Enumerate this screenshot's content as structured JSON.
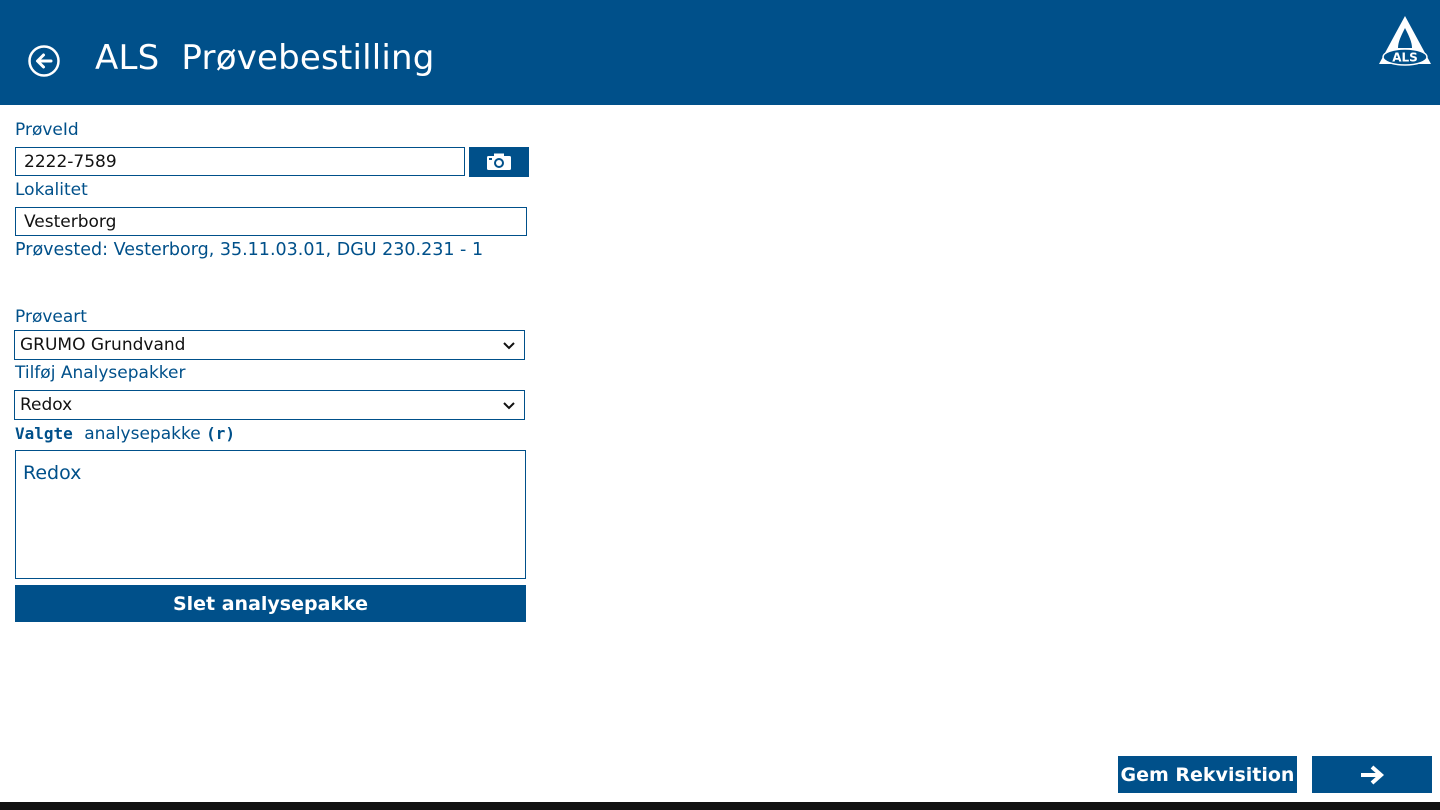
{
  "colors": {
    "brand": "#00508a",
    "background": "#ffffff",
    "text": "#111111"
  },
  "header": {
    "app_name": "ALS",
    "title": "Prøvebestilling",
    "back_icon": "back-arrow-circle-icon",
    "logo_icon": "als-logo-icon",
    "logo_text": "ALS"
  },
  "form": {
    "sample_id": {
      "label": "PrøveId",
      "value": "2222-7589",
      "camera_icon": "camera-icon"
    },
    "locality": {
      "label": "Lokalitet",
      "value": "Vesterborg"
    },
    "sample_site_text": "Prøvested: Vesterborg, 35.11.03.01, DGU 230.231 - 1",
    "sample_type": {
      "label": "Prøveart",
      "selected": "GRUMO Grundvand"
    },
    "add_packages": {
      "label": "Tilføj Analysepakker",
      "selected": "Redox"
    },
    "selected_packages": {
      "label_part1": "Valgte",
      "label_part2": "analysepakke",
      "label_part3": "(r)",
      "items": [
        "Redox"
      ]
    },
    "delete_button": "Slet analysepakke"
  },
  "footer": {
    "save_button": "Gem Rekvisition",
    "next_icon": "arrow-right-icon"
  }
}
